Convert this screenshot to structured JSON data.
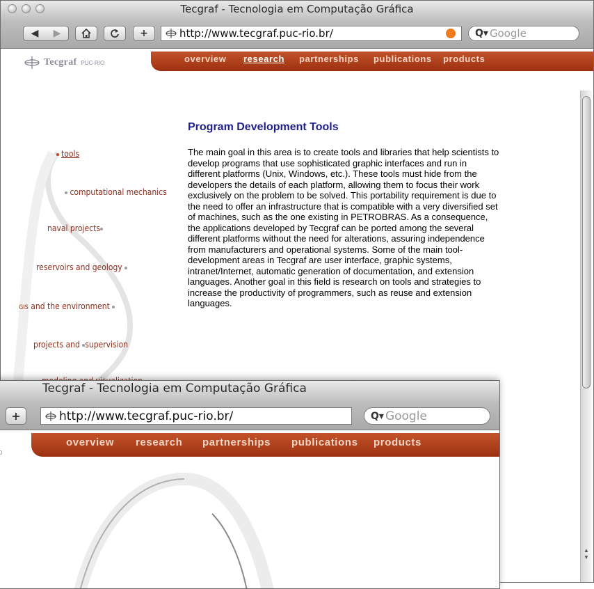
{
  "window": {
    "title": "Tecgraf - Tecnologia em Computação Gráfica",
    "url": "http://www.tecgraf.puc-rio.br/",
    "search_placeholder": "Google"
  },
  "toolbar": {
    "back_icon": "back-arrow-icon",
    "forward_icon": "forward-arrow-icon",
    "home_icon": "home-icon",
    "reload_icon": "reload-icon",
    "add_label": "+"
  },
  "site": {
    "logo_name": "Tecgraf",
    "logo_sub": "PUC-RIO",
    "brand_color": "#a83a17",
    "nav": [
      "overview",
      "research",
      "partnerships",
      "publications",
      "products"
    ],
    "active_nav": "research"
  },
  "sidenav": [
    "tools",
    "computational mechanics",
    "naval projects",
    "reservoirs and geology",
    "GIS",
    "and the environment",
    "projects and",
    "supervision",
    "modeling and visualization"
  ],
  "main": {
    "title": "Program Development Tools",
    "body": "The main goal in this area is to create tools and libraries that help scientists to develop programs that use sophisticated graphic interfaces and run in different platforms (Unix, Windows, etc.). These tools must hide from the developers the details of each platform, allowing them to focus their work exclusively on the problem to be solved. This portability requirement is due to the need to offer an infrastructure that is compatible with a very diversified set of machines, such as the one existing in PETROBRAS. As a consequence, the applications developed by Tecgraf can be ported among the several different platforms without the need for alterations, assuring independence from manufacturers and operational systems. Some of the main tool-development areas in Tecgraf are user interface, graphic systems, intranet/Internet, automatic generation of documentation, and extension languages. Another goal in this field is research on tools and strategies to increase the productivity of programmers, such as reuse and extension languages."
  }
}
